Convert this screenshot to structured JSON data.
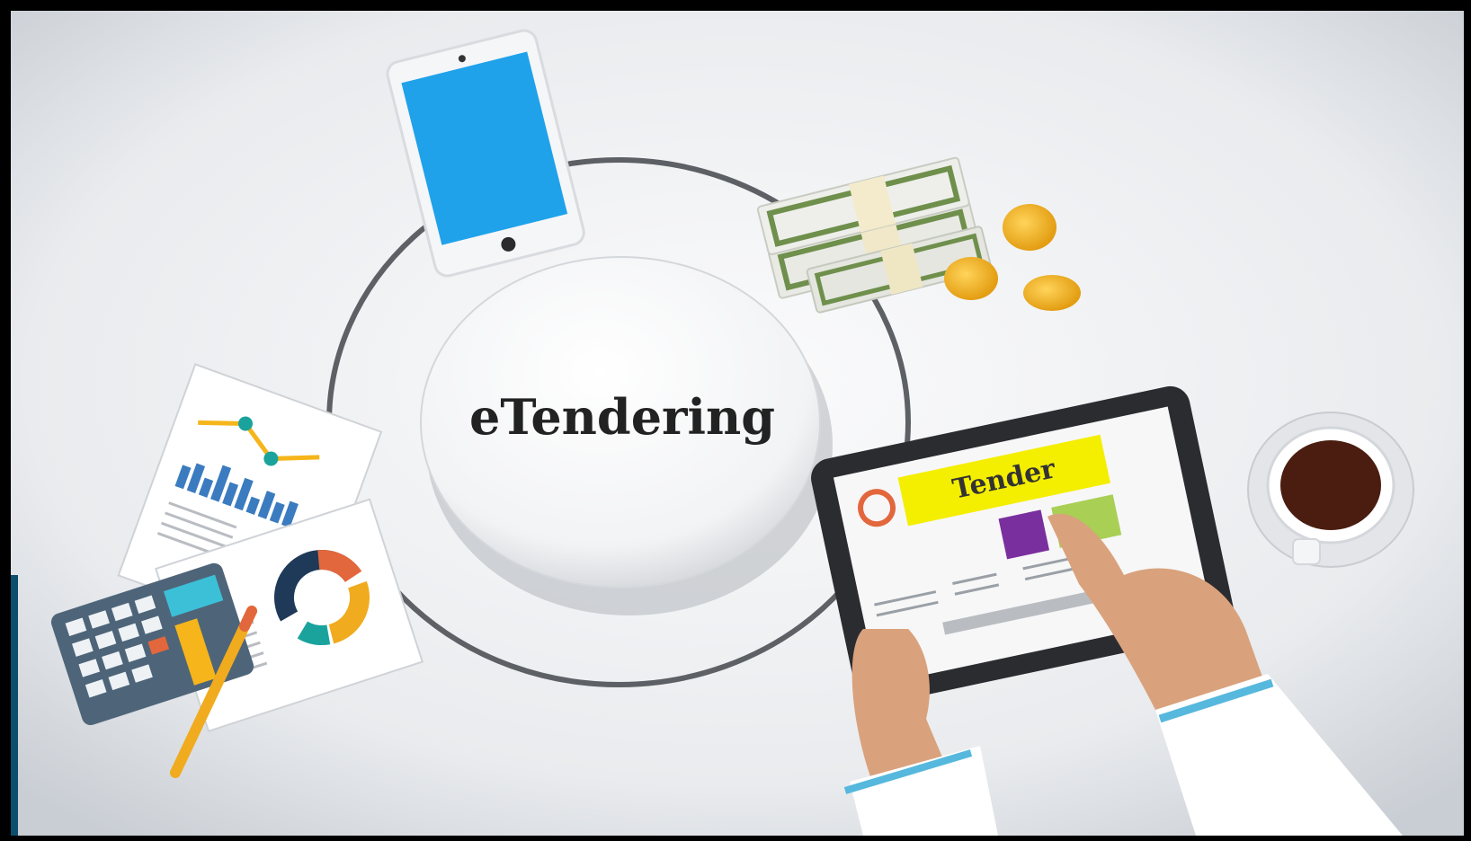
{
  "scene": {
    "center_label": "eTendering",
    "tablet_banner": "Tender"
  },
  "colors": {
    "background": "#e7e9ec",
    "phone_screen": "#1fa2ea",
    "banner_yellow": "#f4ee00",
    "purple_tile": "#7a2f9e",
    "green_tile": "#a9cf55",
    "coin_gold": "#f0b31c",
    "cash_green": "#6f8f4c",
    "coffee": "#4a1d10",
    "skin": "#d9a27c",
    "cuff_blue": "#56b8dd"
  },
  "icons": [
    "smartphone-icon",
    "money-stack-icon",
    "coins-icon",
    "coffee-cup-icon",
    "tablet-icon",
    "report-chart-icon",
    "calculator-icon",
    "pencil-icon",
    "donut-chart-icon"
  ]
}
